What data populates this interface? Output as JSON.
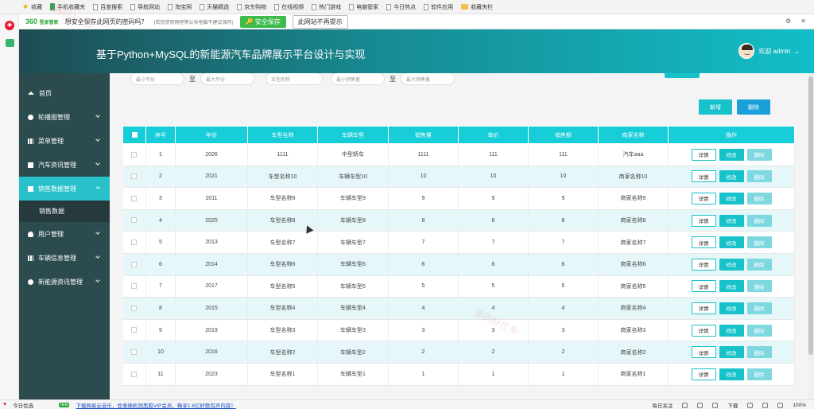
{
  "browser": {
    "bookmarks": [
      {
        "label": "收藏",
        "icon": "star-icon"
      },
      {
        "label": "手机收藏夹",
        "icon": "phone-icon"
      },
      {
        "label": "百度搜索",
        "icon": "doc-icon"
      },
      {
        "label": "导航网站",
        "icon": "doc-icon"
      },
      {
        "label": "淘宝网",
        "icon": "doc-icon"
      },
      {
        "label": "天猫精选",
        "icon": "doc-icon"
      },
      {
        "label": "京东购物",
        "icon": "doc-icon"
      },
      {
        "label": "在线视频",
        "icon": "doc-icon"
      },
      {
        "label": "热门游戏",
        "icon": "doc-icon"
      },
      {
        "label": "电脑管家",
        "icon": "doc-icon"
      },
      {
        "label": "今日热点",
        "icon": "doc-icon"
      },
      {
        "label": "软件应用",
        "icon": "doc-icon"
      },
      {
        "label": "收藏夹栏",
        "icon": "folder-icon"
      }
    ],
    "password_bar": {
      "logo": "360",
      "logo_sub": "登录管家",
      "question": "想安全保存此网页的密码吗？",
      "note": "(若您使用网吧等公共电脑不建议保存)",
      "save_label": "安全保存",
      "no_save_label": "此网站不再提示"
    },
    "status": {
      "left_label": "今日优选",
      "badge": "new",
      "ad_text": "下载网易云音乐，登录随机领黑胶VIP会员，畅享1.8亿好歌有声内容！",
      "daily": "每日关注",
      "download": "下载",
      "zoom": "100%"
    }
  },
  "header": {
    "title": "基于Python+MySQL的新能源汽车品牌展示平台设计与实现",
    "user_label": "欢迎 admin"
  },
  "sidebar": {
    "items": [
      {
        "label": "首页",
        "icon": "home-icon"
      },
      {
        "label": "轮播图管理",
        "icon": "image-icon"
      },
      {
        "label": "菜单管理",
        "icon": "menu-icon"
      },
      {
        "label": "汽车资讯管理",
        "icon": "list-icon"
      },
      {
        "label": "销售数据管理",
        "icon": "list-icon"
      },
      {
        "label": "用户管理",
        "icon": "user-icon"
      },
      {
        "label": "车辆信息管理",
        "icon": "car-icon"
      },
      {
        "label": "新能源资讯管理",
        "icon": "info-icon"
      }
    ],
    "sub_item": "销售数据"
  },
  "search": {
    "min_year": "最小年份",
    "max_year": "最大年份",
    "model_name": "车型名称",
    "min_sales": "最小销售量",
    "max_sales": "最大销售量",
    "to": "至"
  },
  "actions": {
    "add": "新增",
    "delete": "删除"
  },
  "table": {
    "headers": [
      "序号",
      "年份",
      "车型名称",
      "车辆车型",
      "销售量",
      "单价",
      "销售额",
      "商家名称",
      "操作"
    ],
    "row_actions": {
      "detail": "详情",
      "edit": "修改",
      "delete": "删除"
    },
    "rows": [
      [
        "1",
        "2026",
        "1111",
        "中型轿车",
        "1111",
        "111",
        "111",
        "汽车aaa"
      ],
      [
        "2",
        "2021",
        "车型名称10",
        "车辆车型10",
        "10",
        "10",
        "10",
        "商家名称10"
      ],
      [
        "3",
        "2011",
        "车型名称9",
        "车辆车型9",
        "9",
        "9",
        "9",
        "商家名称9"
      ],
      [
        "4",
        "2025",
        "车型名称8",
        "车辆车型8",
        "8",
        "8",
        "8",
        "商家名称8"
      ],
      [
        "5",
        "2013",
        "车型名称7",
        "车辆车型7",
        "7",
        "7",
        "7",
        "商家名称7"
      ],
      [
        "6",
        "2014",
        "车型名称6",
        "车辆车型6",
        "6",
        "6",
        "6",
        "商家名称6"
      ],
      [
        "7",
        "2017",
        "车型名称5",
        "车辆车型5",
        "5",
        "5",
        "5",
        "商家名称5"
      ],
      [
        "8",
        "2015",
        "车型名称4",
        "车辆车型4",
        "4",
        "4",
        "4",
        "商家名称4"
      ],
      [
        "9",
        "2019",
        "车型名称3",
        "车辆车型3",
        "3",
        "3",
        "3",
        "商家名称3"
      ],
      [
        "10",
        "2016",
        "车型名称2",
        "车辆车型2",
        "2",
        "2",
        "2",
        "商家名称2"
      ],
      [
        "11",
        "2023",
        "车型名称1",
        "车辆车型1",
        "1",
        "1",
        "1",
        "商家名称1"
      ]
    ]
  },
  "watermark": "源码好优多",
  "colors": {
    "accent": "#17c2cb",
    "sidebar_bg": "#2b4b4f",
    "row_alt": "#e6f7f9"
  }
}
